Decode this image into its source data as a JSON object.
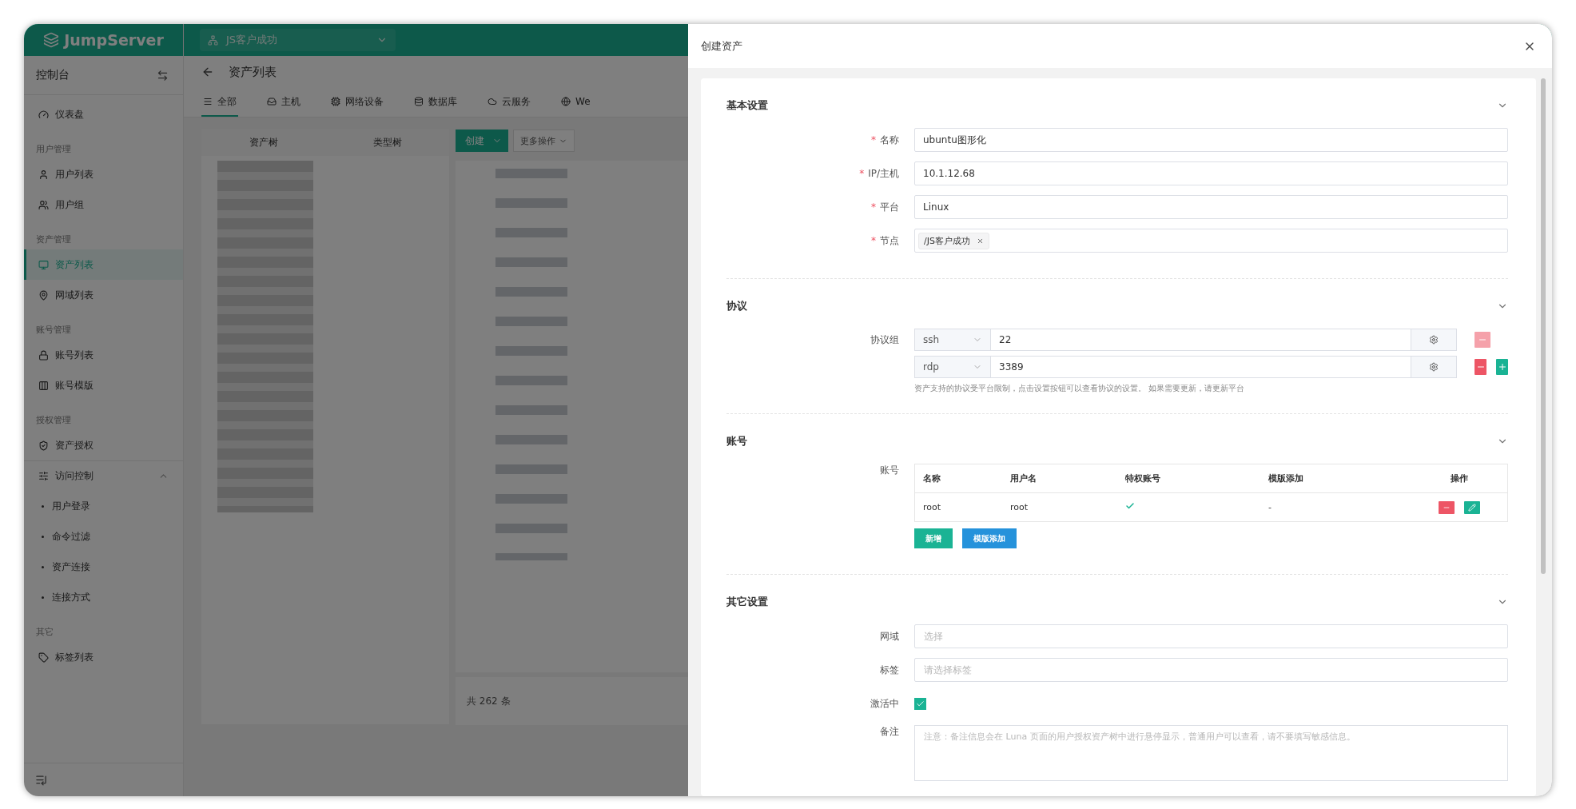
{
  "app": {
    "logo": "JumpServer",
    "org": "JS客户成功"
  },
  "sidebar": {
    "title": "控制台",
    "items": [
      {
        "kind": "item",
        "label": "仪表盘",
        "selected": false
      },
      {
        "kind": "group",
        "label": "用户管理"
      },
      {
        "kind": "item",
        "label": "用户列表",
        "selected": false
      },
      {
        "kind": "item",
        "label": "用户组",
        "selected": false
      },
      {
        "kind": "group",
        "label": "资产管理"
      },
      {
        "kind": "item",
        "label": "资产列表",
        "selected": true
      },
      {
        "kind": "item",
        "label": "网域列表",
        "selected": false
      },
      {
        "kind": "group",
        "label": "账号管理"
      },
      {
        "kind": "item",
        "label": "账号列表",
        "selected": false
      },
      {
        "kind": "item",
        "label": "账号模版",
        "selected": false
      },
      {
        "kind": "group",
        "label": "授权管理"
      },
      {
        "kind": "item",
        "label": "资产授权",
        "selected": false
      },
      {
        "kind": "submenu",
        "label": "访问控制",
        "expanded": true,
        "children": [
          {
            "label": "用户登录",
            "selected": false
          },
          {
            "label": "命令过滤",
            "selected": false
          },
          {
            "label": "资产连接",
            "selected": false
          },
          {
            "label": "连接方式",
            "selected": false
          }
        ]
      },
      {
        "kind": "group",
        "label": "其它"
      },
      {
        "kind": "item",
        "label": "标签列表",
        "selected": false
      }
    ]
  },
  "main": {
    "page_title": "资产列表",
    "tabs": [
      {
        "label": "全部",
        "selected": true
      },
      {
        "label": "主机",
        "selected": false
      },
      {
        "label": "网络设备",
        "selected": false
      },
      {
        "label": "数据库",
        "selected": false
      },
      {
        "label": "云服务",
        "selected": false
      },
      {
        "label": "We",
        "selected": false
      }
    ],
    "tree_tabs": [
      "资产树",
      "类型树"
    ],
    "create_button": "创建",
    "more_button": "更多操作",
    "total": "共 262 条"
  },
  "drawer": {
    "title": "创建资产",
    "basic": {
      "title": "基本设置",
      "fields": [
        {
          "kind": "text",
          "label": "名称",
          "required_mark": "*",
          "value": "ubuntu图形化"
        },
        {
          "kind": "text",
          "label": "IP/主机",
          "required_mark": "*",
          "value": "10.1.12.68"
        },
        {
          "kind": "text",
          "label": "平台",
          "required_mark": "*",
          "value": "Linux"
        },
        {
          "kind": "tags",
          "label": "节点",
          "required_mark": "*",
          "tags": [
            "/JS客户成功"
          ]
        }
      ]
    },
    "protocol": {
      "title": "协议",
      "label": "协议组",
      "rows": [
        {
          "name": "ssh",
          "port": "22",
          "remove_disabled": true,
          "add": false
        },
        {
          "name": "rdp",
          "port": "3389",
          "remove_disabled": false,
          "add": true
        }
      ],
      "hint": "资产支持的协议受平台限制，点击设置按钮可以查看协议的设置。 如果需要更新，请更新平台"
    },
    "accounts": {
      "title": "账号",
      "label": "账号",
      "columns": [
        "名称",
        "用户名",
        "特权账号",
        "模版添加",
        "操作"
      ],
      "rows": [
        {
          "name": "root",
          "username": "root",
          "privileged": true,
          "template": "-"
        }
      ],
      "buttons": [
        {
          "kind": "add",
          "label": "新增"
        },
        {
          "kind": "template",
          "label": "模版添加"
        }
      ]
    },
    "other": {
      "title": "其它设置",
      "fields": [
        {
          "kind": "select",
          "label": "网域",
          "placeholder": "选择"
        },
        {
          "kind": "select",
          "label": "标签",
          "placeholder": "请选择标签"
        },
        {
          "kind": "checkbox",
          "label": "激活中",
          "checked": true
        },
        {
          "kind": "textarea",
          "label": "备注",
          "placeholder": "注意：备注信息会在 Luna 页面的用户授权资产树中进行悬停显示，普通用户可以查看，请不要填写敏感信息。"
        }
      ]
    }
  }
}
